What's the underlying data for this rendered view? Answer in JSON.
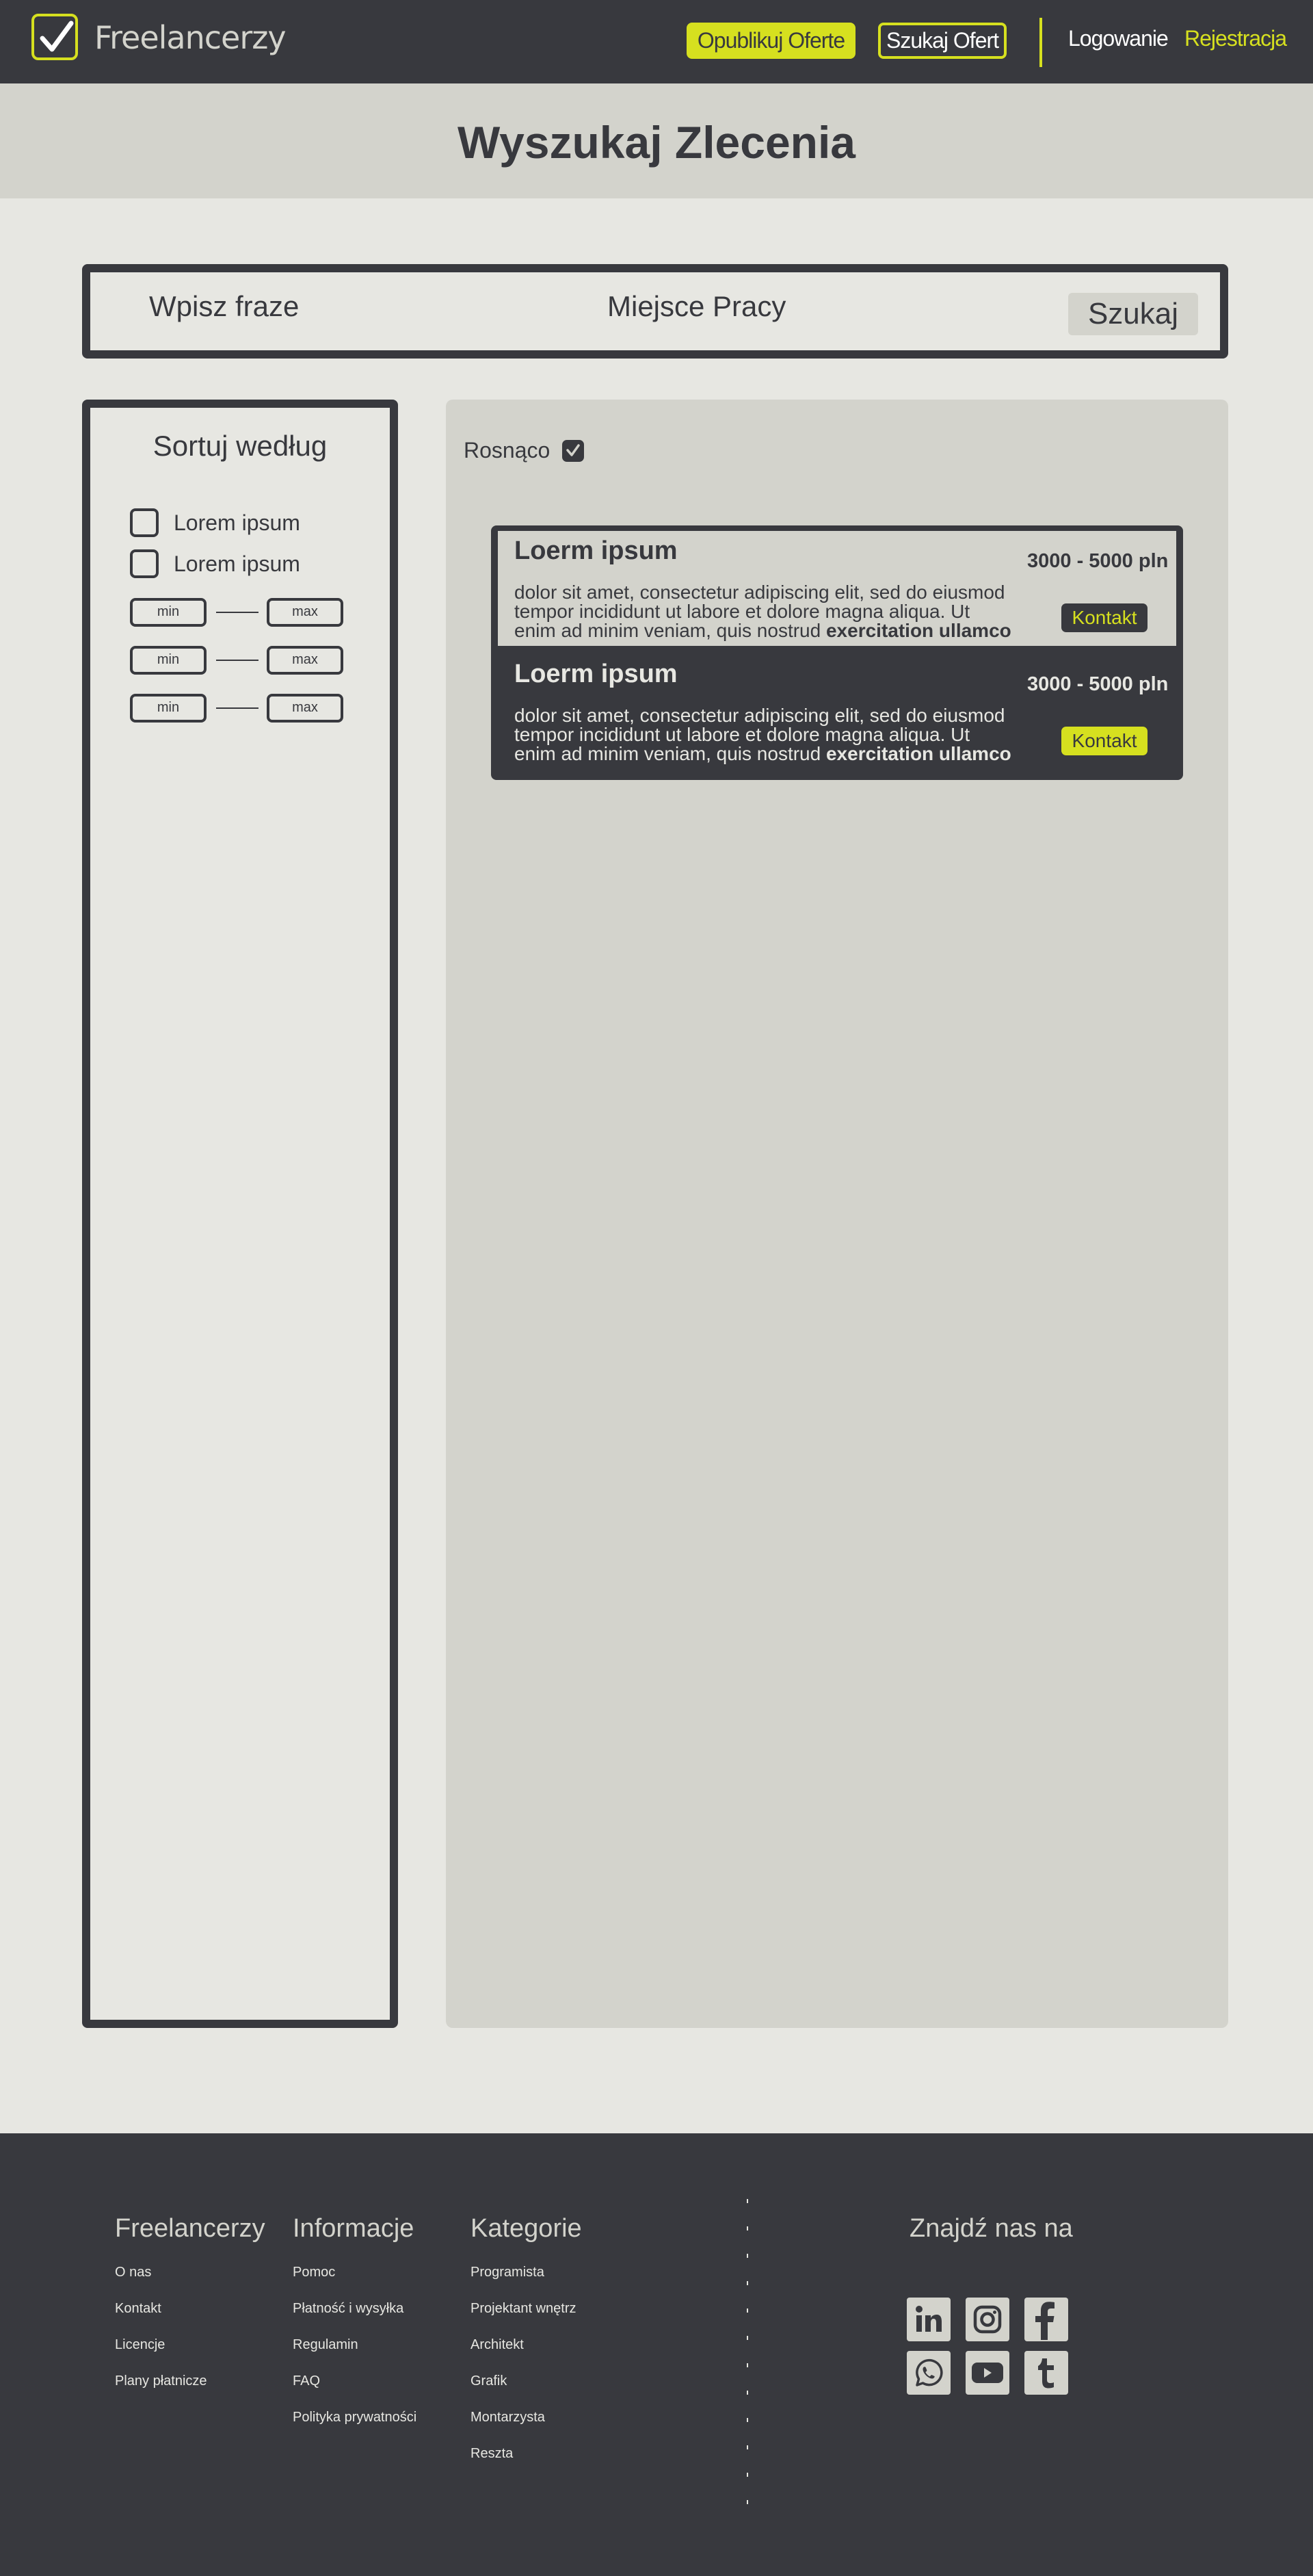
{
  "header": {
    "logo_text": "Freelancerzy",
    "publish_button": "Opublikuj Oferte",
    "search_offers_button": "Szukaj Ofert",
    "login_link": "Logowanie",
    "register_link": "Rejestracja"
  },
  "page_title": "Wyszukaj Zlecenia",
  "search": {
    "phrase_placeholder": "Wpisz fraze",
    "place_placeholder": "Miejsce Pracy",
    "button": "Szukaj"
  },
  "sidebar": {
    "title": "Sortuj według",
    "checkboxes": [
      "Lorem ipsum",
      "Lorem ipsum"
    ],
    "ranges": [
      {
        "min": "min",
        "max": "max"
      },
      {
        "min": "min",
        "max": "max"
      },
      {
        "min": "min",
        "max": "max"
      }
    ]
  },
  "results": {
    "sort_order_label": "Rosnąco",
    "offers": [
      {
        "title": "Loerm ipsum",
        "price": "3000 - 5000 pln",
        "desc_1": "dolor sit amet, consectetur adipiscing elit, sed do eiusmod",
        "desc_2": "tempor incididunt ut labore et dolore magna aliqua. Ut",
        "desc_3": "enim ad minim veniam, quis nostrud ",
        "desc_bold": "exercitation ullamco",
        "contact": "Kontakt"
      },
      {
        "title": "Loerm ipsum",
        "price": "3000 - 5000 pln",
        "desc_1": "dolor sit amet, consectetur adipiscing elit, sed do eiusmod",
        "desc_2": "tempor incididunt ut labore et dolore magna aliqua. Ut",
        "desc_3": "enim ad minim veniam, quis nostrud ",
        "desc_bold": "exercitation ullamco",
        "contact": "Kontakt"
      }
    ]
  },
  "footer": {
    "col1": {
      "title": "Freelancerzy",
      "links": [
        "O nas",
        "Kontakt",
        "Licencje",
        "Plany płatnicze"
      ]
    },
    "col2": {
      "title": "Informacje",
      "links": [
        "Pomoc",
        "Płatność i wysyłka",
        "Regulamin",
        "FAQ",
        "Polityka prywatności"
      ]
    },
    "col3": {
      "title": "Kategorie",
      "links": [
        "Programista",
        "Projektant wnętrz",
        "Architekt",
        "Grafik",
        "Montarzysta",
        "Reszta"
      ]
    },
    "find_us": "Znajdź nas na",
    "social_icons": [
      "linkedin-icon",
      "instagram-icon",
      "facebook-icon",
      "whatsapp-icon",
      "youtube-icon",
      "tumblr-icon"
    ]
  },
  "colors": {
    "dark": "#38393e",
    "accent": "#d6e01f",
    "light": "#e7e7e2",
    "panel": "#d3d3cc"
  }
}
